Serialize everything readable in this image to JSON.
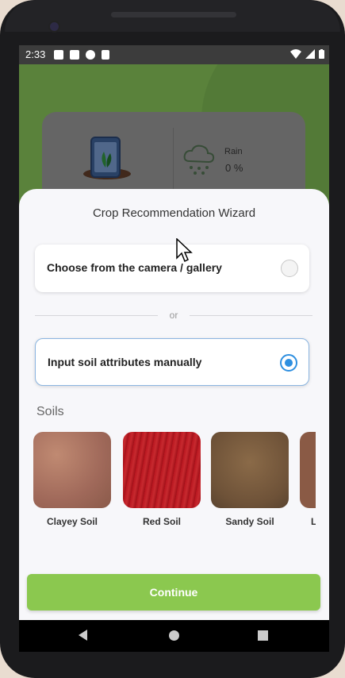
{
  "status_bar": {
    "time": "2:33"
  },
  "background_card": {
    "rain_label": "Rain",
    "rain_value": "0 %"
  },
  "wizard": {
    "title": "Crop Recommendation Wizard",
    "option_camera": "Choose from the camera / gallery",
    "option_camera_selected": false,
    "separator": "or",
    "option_manual": "Input soil attributes manually",
    "option_manual_selected": true,
    "soils_heading": "Soils",
    "soils": [
      {
        "name": "Clayey Soil"
      },
      {
        "name": "Red Soil"
      },
      {
        "name": "Sandy Soil"
      },
      {
        "name": "L"
      }
    ],
    "continue_label": "Continue"
  },
  "colors": {
    "accent_green": "#8bc84f",
    "radio_blue": "#2e8fe0",
    "app_green": "#7db453"
  }
}
